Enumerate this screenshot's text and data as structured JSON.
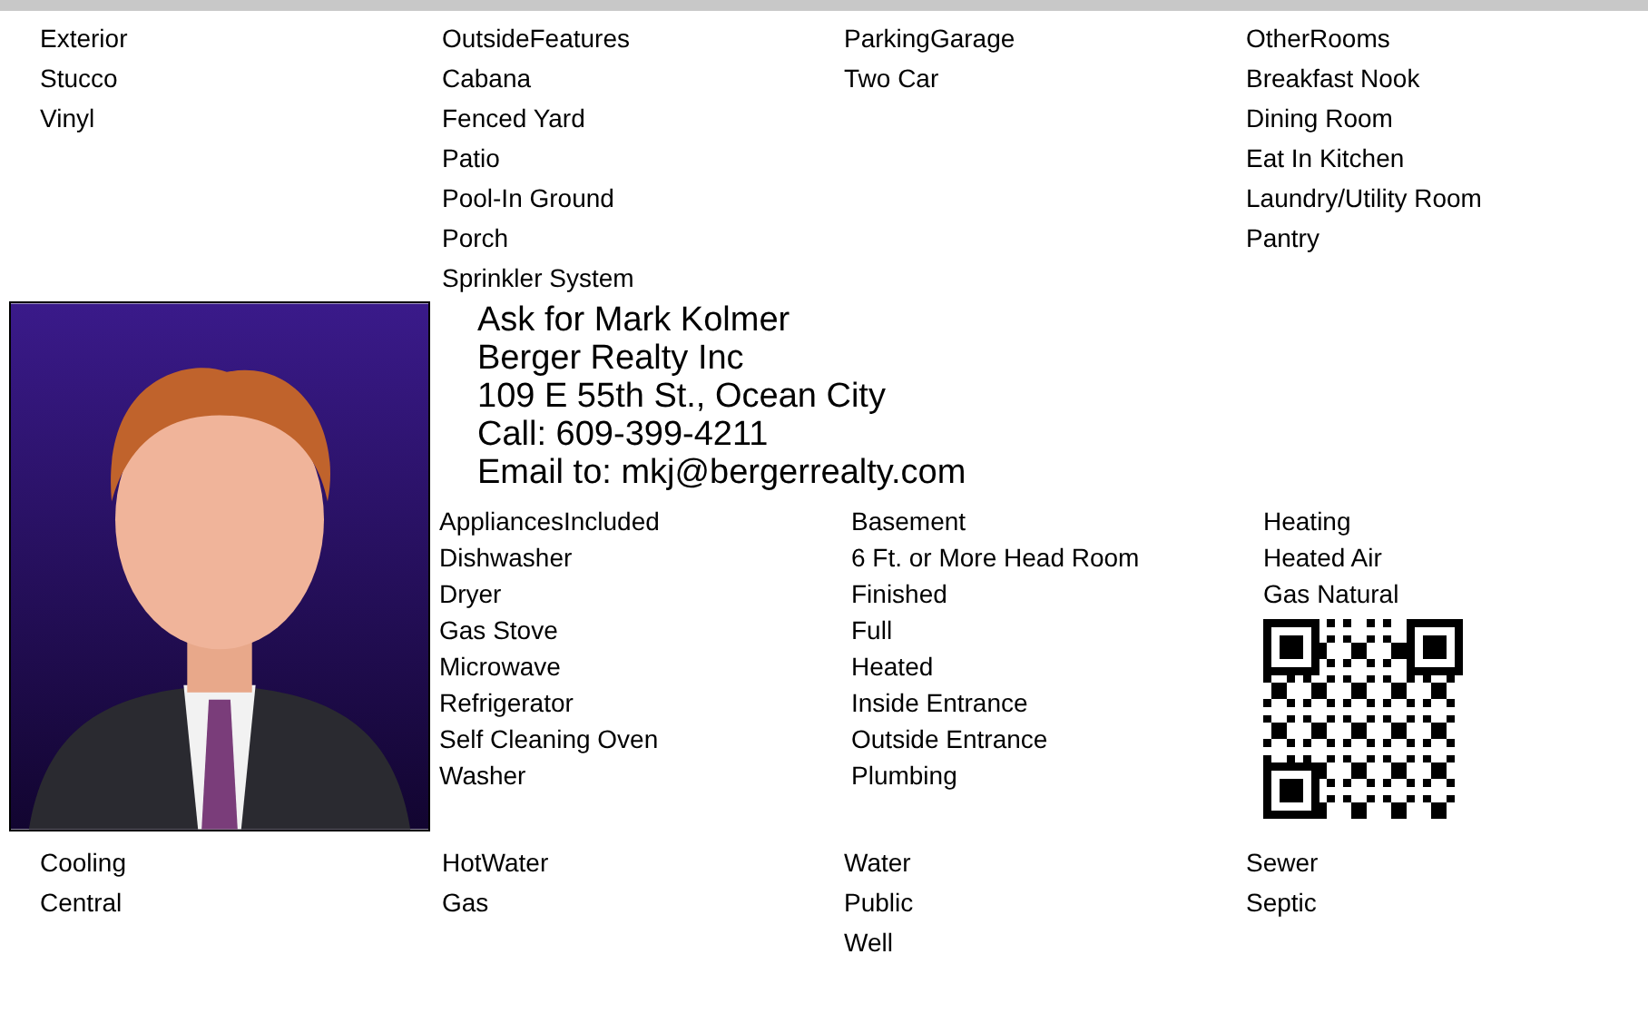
{
  "features_top": [
    {
      "heading": "Exterior",
      "items": [
        "Stucco",
        "Vinyl"
      ]
    },
    {
      "heading": "OutsideFeatures",
      "items": [
        "Cabana",
        "Fenced Yard",
        "Patio",
        "Pool-In Ground",
        "Porch",
        "Sprinkler System"
      ]
    },
    {
      "heading": "ParkingGarage",
      "items": [
        "Two Car"
      ]
    },
    {
      "heading": "OtherRooms",
      "items": [
        "Breakfast Nook",
        "Dining Room",
        "Eat In Kitchen",
        "Laundry/Utility Room",
        "Pantry"
      ]
    }
  ],
  "agent": {
    "lines": [
      "Ask for Mark Kolmer",
      "Berger Realty Inc",
      "109 E 55th St., Ocean City",
      "Call: 609-399-4211",
      "Email to: mkj@bergerrealty.com"
    ]
  },
  "features_middle": [
    {
      "heading": "AppliancesIncluded",
      "items": [
        "Dishwasher",
        "Dryer",
        "Gas Stove",
        "Microwave",
        "Refrigerator",
        "Self Cleaning Oven",
        "Washer"
      ]
    },
    {
      "heading": "Basement",
      "items": [
        "6 Ft. or More Head Room",
        "Finished",
        "Full",
        "Heated",
        "Inside Entrance",
        "Outside Entrance",
        "Plumbing"
      ]
    },
    {
      "heading": "Heating",
      "items": [
        "Heated Air",
        "Gas Natural"
      ]
    }
  ],
  "features_bottom": [
    {
      "heading": "Cooling",
      "items": [
        "Central"
      ]
    },
    {
      "heading": "HotWater",
      "items": [
        "Gas"
      ]
    },
    {
      "heading": "Water",
      "items": [
        "Public",
        "Well"
      ]
    },
    {
      "heading": "Sewer",
      "items": [
        "Septic"
      ]
    }
  ]
}
